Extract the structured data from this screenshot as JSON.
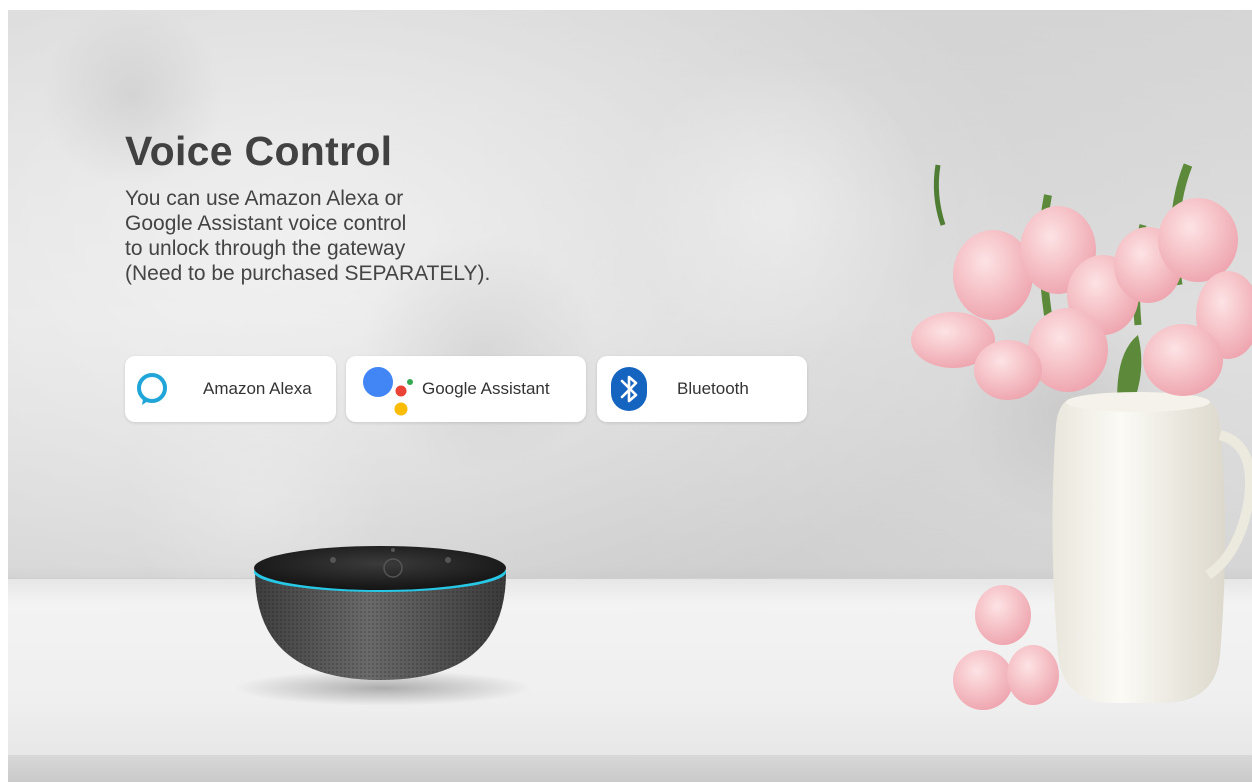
{
  "hero": {
    "title": "Voice Control",
    "description_lines": [
      "You can use Amazon Alexa or",
      "Google Assistant voice control",
      "to unlock through the gateway",
      "(Need to be purchased SEPARATELY)."
    ]
  },
  "badges": [
    {
      "label": "Amazon Alexa",
      "icon": "alexa-ring-icon",
      "color": "#1fa5d8"
    },
    {
      "label": "Google Assistant",
      "icon": "google-assistant-dots-icon",
      "colors": [
        "#4285f4",
        "#ea4335",
        "#fbbc05",
        "#34a853"
      ]
    },
    {
      "label": "Bluetooth",
      "icon": "bluetooth-icon",
      "color": "#1565c0"
    }
  ],
  "accent_colors": {
    "speaker_ring": "#27c8e6",
    "flowers": "#f2b6bd",
    "vase": "#f7f4ec"
  }
}
